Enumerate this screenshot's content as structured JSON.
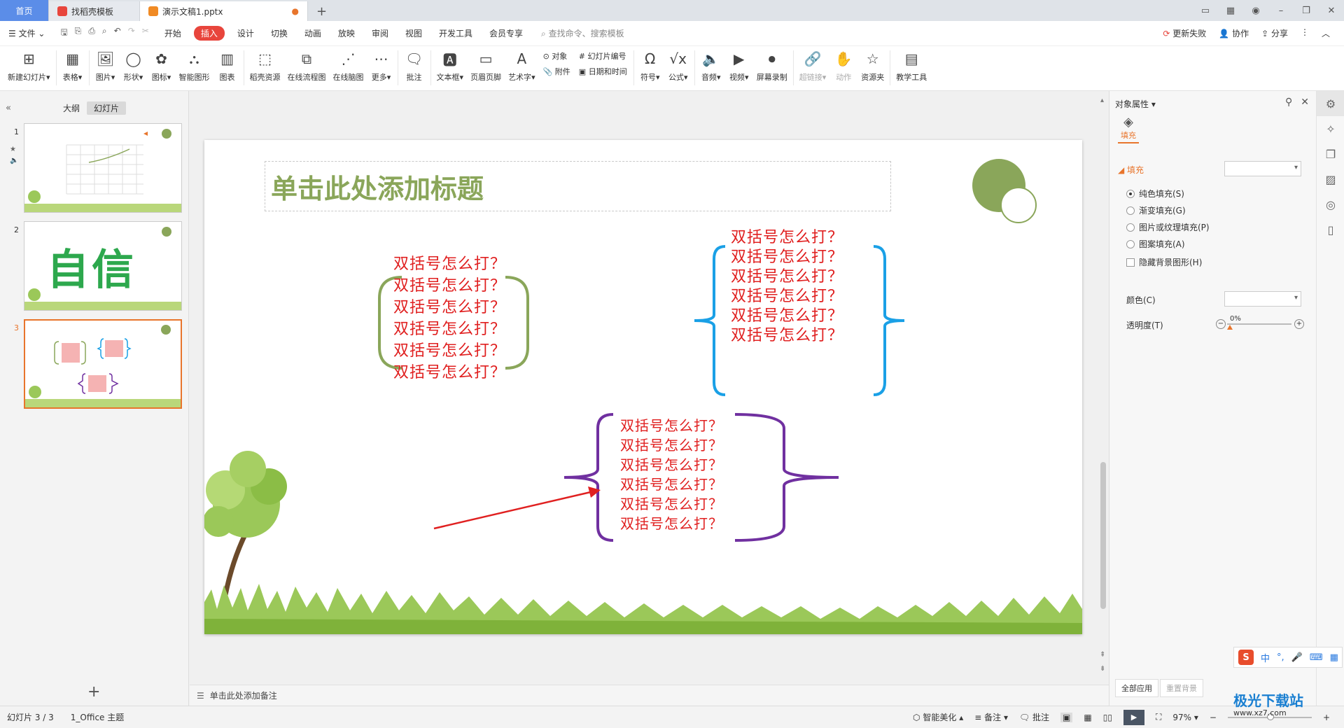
{
  "tabs": {
    "home": "首页",
    "template": "找稻壳模板",
    "doc": "演示文稿1.pptx"
  },
  "menu": {
    "file": "文件",
    "items": [
      "开始",
      "插入",
      "设计",
      "切换",
      "动画",
      "放映",
      "审阅",
      "视图",
      "开发工具",
      "会员专享"
    ],
    "active": "插入",
    "search": "查找命令、搜索模板",
    "update": "更新失败",
    "collab": "协作",
    "share": "分享"
  },
  "ribbon": {
    "new_slide": "新建幻灯片",
    "table": "表格",
    "picture": "图片",
    "shape": "形状",
    "icon": "图标",
    "smartart": "智能图形",
    "chart": "图表",
    "docer": "稻壳资源",
    "flowchart": "在线流程图",
    "mindmap": "在线脑图",
    "more": "更多",
    "comment": "批注",
    "textbox": "文本框",
    "headerfooter": "页眉页脚",
    "wordart": "艺术字",
    "object": "对象",
    "attachment": "附件",
    "slidenum": "幻灯片编号",
    "datetime": "日期和时间",
    "symbol": "符号",
    "formula": "公式",
    "audio": "音频",
    "video": "视频",
    "screenrec": "屏幕录制",
    "hyperlink": "超链接",
    "action": "动作",
    "resource": "资源夹",
    "teaching": "教学工具"
  },
  "left_panel": {
    "outline": "大纲",
    "slides": "幻灯片",
    "thumbs": [
      "1",
      "2",
      "3"
    ],
    "thumb2_text": "自信"
  },
  "slide": {
    "title": "单击此处添加标题",
    "block_green": [
      "双括号怎么打？",
      "双括号怎么打？",
      "双括号怎么打？",
      "双括号怎么打？",
      "双括号怎么打？",
      "双括号怎么打？"
    ],
    "block_blue": [
      "双括号怎么打？",
      "双括号怎么打？",
      "双括号怎么打？",
      "双括号怎么打？",
      "双括号怎么打？",
      "双括号怎么打？"
    ],
    "block_purple": [
      "双括号怎么打？",
      "双括号怎么打？",
      "双括号怎么打？",
      "双括号怎么打？",
      "双括号怎么打？",
      "双括号怎么打？"
    ],
    "colors": {
      "green": "#8aa65a",
      "blue": "#1aa0e6",
      "purple": "#7030a0",
      "text": "#e02020",
      "arrow": "#e02020"
    }
  },
  "notes": "单击此处添加备注",
  "right_panel": {
    "title": "对象属性",
    "tab_fill": "填充",
    "section_fill": "填充",
    "options": [
      "纯色填充(S)",
      "渐变填充(G)",
      "图片或纹理填充(P)",
      "图案填充(A)"
    ],
    "hide_bg": "隐藏背景图形(H)",
    "color_label": "颜色(C)",
    "transparency_label": "透明度(T)",
    "transparency_value": "0%",
    "apply_all": "全部应用",
    "reset_bg": "重置背景"
  },
  "status": {
    "slide_info": "幻灯片 3 / 3",
    "theme": "1_Office 主题",
    "beautify": "智能美化",
    "notes": "备注",
    "comments": "批注",
    "zoom": "97%"
  },
  "ime": {
    "lang": "中"
  },
  "watermark": {
    "brand": "极光下载站",
    "url": "www.xz7.com"
  }
}
